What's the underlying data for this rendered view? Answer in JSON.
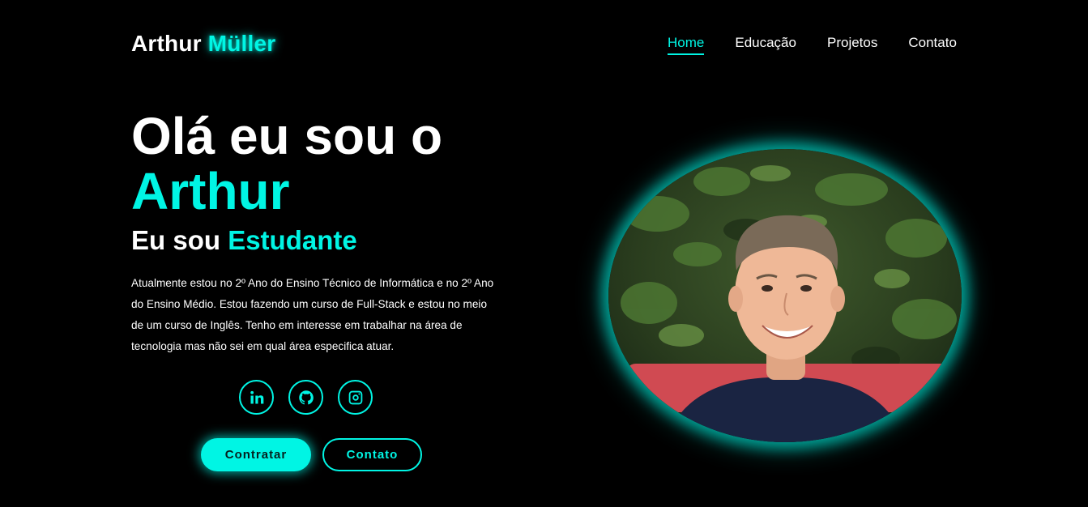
{
  "header": {
    "logo_first": "Arthur",
    "logo_last": "Müller",
    "nav": [
      {
        "label": "Home",
        "active": true
      },
      {
        "label": "Educação",
        "active": false
      },
      {
        "label": "Projetos",
        "active": false
      },
      {
        "label": "Contato",
        "active": false
      }
    ]
  },
  "hero": {
    "greeting": "Olá eu sou o",
    "name": "Arthur",
    "role_prefix": "Eu sou",
    "role": "Estudante",
    "bio": "Atualmente estou no 2º Ano do Ensino Técnico de Informática e no 2º Ano do Ensino Médio. Estou fazendo um curso de Full-Stack e estou no meio de um curso de Inglês. Tenho em interesse em trabalhar na área de tecnologia mas não sei em qual área especifica atuar."
  },
  "socials": [
    {
      "icon": "linkedin-icon"
    },
    {
      "icon": "github-icon"
    },
    {
      "icon": "instagram-icon"
    }
  ],
  "buttons": {
    "primary": "Contratar",
    "secondary": "Contato"
  },
  "colors": {
    "accent": "#00f5e4",
    "background": "#000000",
    "text": "#ffffff"
  }
}
